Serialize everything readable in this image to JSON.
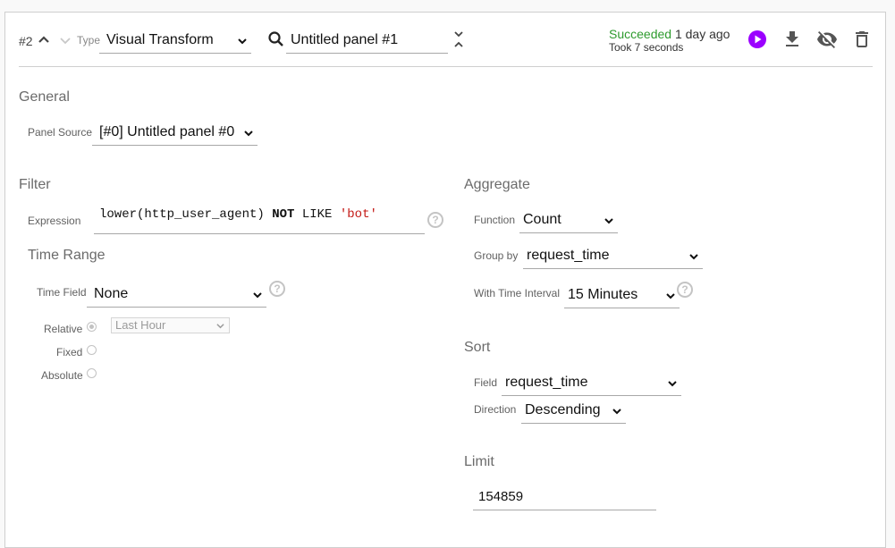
{
  "header": {
    "panel_index": "#2",
    "type_label": "Type",
    "type_value": "Visual Transform",
    "panel_name": "Untitled panel #1",
    "status_text": "Succeeded",
    "status_time": "1 day ago",
    "duration": "Took 7 seconds",
    "colors": {
      "success": "#2e9b2e",
      "run_button": "#9b00ff",
      "icon": "#555555"
    },
    "icons": [
      "chevron-up-icon",
      "chevron-down-icon",
      "search-icon",
      "expand-collapse-icon",
      "play-icon",
      "download-icon",
      "visibility-off-icon",
      "trash-icon"
    ]
  },
  "general": {
    "title": "General",
    "panel_source_label": "Panel Source",
    "panel_source_value": "[#0] Untitled panel #0"
  },
  "filter": {
    "title": "Filter",
    "expression_label": "Expression",
    "expression": {
      "part1": "lower(http_user_agent) ",
      "keyword_not": "NOT",
      "part2": " LIKE ",
      "string_literal": "'bot'"
    }
  },
  "time_range": {
    "title": "Time Range",
    "time_field_label": "Time Field",
    "time_field_value": "None",
    "relative_label": "Relative",
    "relative_value": "Last Hour",
    "fixed_label": "Fixed",
    "absolute_label": "Absolute",
    "selected_mode": "Relative"
  },
  "aggregate": {
    "title": "Aggregate",
    "function_label": "Function",
    "function_value": "Count",
    "group_by_label": "Group by",
    "group_by_value": "request_time",
    "interval_label": "With Time Interval",
    "interval_value": "15 Minutes"
  },
  "sort": {
    "title": "Sort",
    "field_label": "Field",
    "field_value": "request_time",
    "direction_label": "Direction",
    "direction_value": "Descending"
  },
  "limit": {
    "title": "Limit",
    "value": "154859"
  },
  "help_glyph": "?"
}
